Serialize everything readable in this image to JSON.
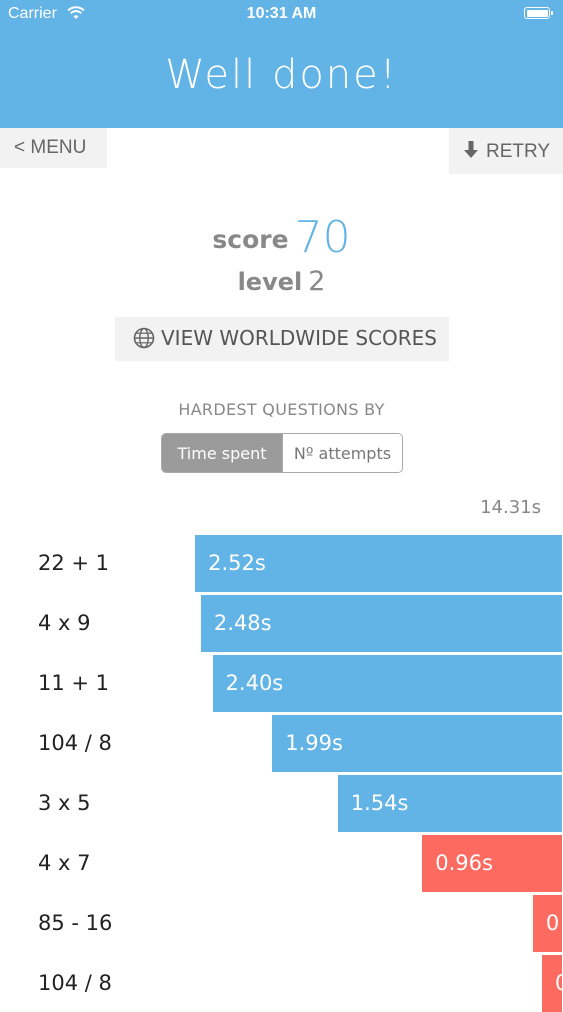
{
  "status_bar": {
    "carrier": "Carrier",
    "time": "10:31 AM"
  },
  "header": {
    "title": "Well done!"
  },
  "nav": {
    "menu_label": "< MENU",
    "retry_label": "RETRY"
  },
  "results": {
    "score_label": "score",
    "score": "70",
    "level_label": "level",
    "level": "2"
  },
  "worldwide_button": {
    "label": "VIEW WORLDWIDE SCORES"
  },
  "hardest": {
    "heading": "HARDEST QUESTIONS BY",
    "tabs": [
      {
        "label": "Time spent",
        "active": true
      },
      {
        "label": "Nº attempts",
        "active": false
      }
    ],
    "max_label": "14.31s"
  },
  "colors": {
    "accent": "#62b3e6",
    "slow": "#62b3e6",
    "fast": "#fc6a60",
    "button_bg": "#f2f2f2"
  },
  "chart_data": {
    "type": "bar",
    "orientation": "horizontal",
    "categories": [
      "22 + 1",
      "4 x 9",
      "11 + 1",
      "104 / 8",
      "3 x 5",
      "4 x 7",
      "85 - 16",
      "104 / 8"
    ],
    "values": [
      2.52,
      2.48,
      2.4,
      1.99,
      1.54,
      0.96,
      0.2,
      0.1
    ],
    "value_labels": [
      "2.52s",
      "2.48s",
      "2.40s",
      "1.99s",
      "1.54s",
      "0.96s",
      "0",
      "0"
    ],
    "bar_colors": [
      "#62b3e6",
      "#62b3e6",
      "#62b3e6",
      "#62b3e6",
      "#62b3e6",
      "#fc6a60",
      "#fc6a60",
      "#fc6a60"
    ],
    "unit": "s"
  }
}
